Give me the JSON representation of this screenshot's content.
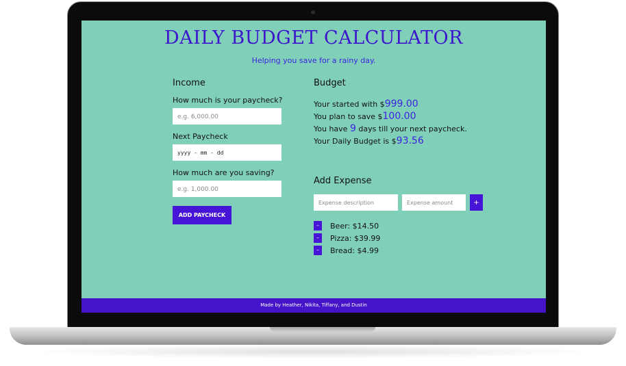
{
  "header": {
    "title": "DAILY BUDGET CALCULATOR",
    "subtitle": "Helping you save for a rainy day."
  },
  "income": {
    "heading": "Income",
    "paycheck_label": "How much is your paycheck?",
    "paycheck_placeholder": "e.g. 6,000.00",
    "next_paycheck_label": "Next Paycheck",
    "date_value": "yyyy - mm - dd",
    "saving_label": "How much are you saving?",
    "saving_placeholder": "e.g. 1,000.00",
    "add_button": "ADD PAYCHECK"
  },
  "budget": {
    "heading": "Budget",
    "started_prefix": "Your started with $",
    "started_value": "999.00",
    "save_prefix": "You plan to save $",
    "save_value": "100.00",
    "days_prefix": "You have ",
    "days_value": "9",
    "days_suffix": " days till your next paycheck.",
    "daily_prefix": "Your Daily Budget is $",
    "daily_value": "93.56"
  },
  "expense": {
    "heading": "Add Expense",
    "description_placeholder": "Expense description",
    "amount_placeholder": "Expense amount",
    "add_label": "+",
    "remove_label": "–",
    "items": [
      {
        "label": "Beer: $14.50"
      },
      {
        "label": "Pizza: $39.99"
      },
      {
        "label": "Bread: $4.99"
      }
    ]
  },
  "footer": {
    "credits": "Made by Heather, Nikita, Tiffany, and Dustin"
  },
  "colors": {
    "background": "#80cfb8",
    "accent": "#4514d6",
    "title": "#3c15cc"
  }
}
